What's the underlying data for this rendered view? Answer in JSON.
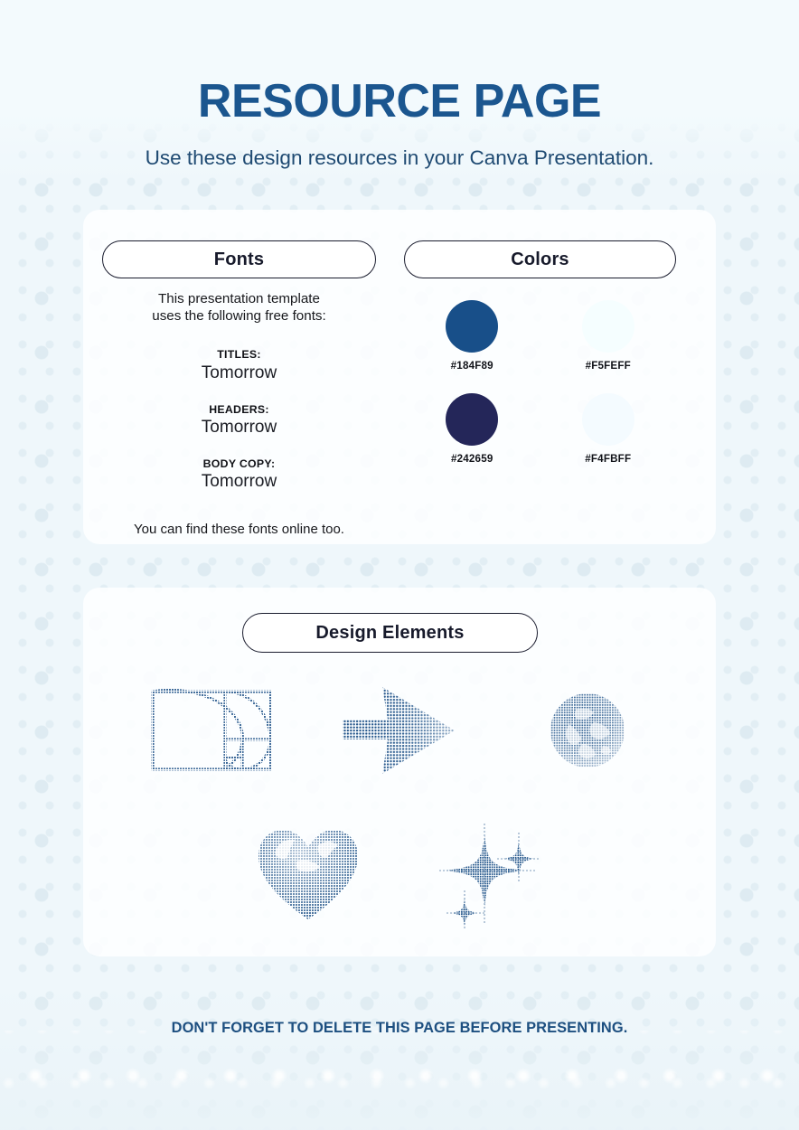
{
  "header": {
    "title": "RESOURCE PAGE",
    "subtitle": "Use these design resources in your Canva Presentation."
  },
  "cards": {
    "resources": {
      "fonts": {
        "pill_label": "Fonts",
        "intro_line_1": "This presentation template",
        "intro_line_2": "uses the following free fonts:",
        "groups": [
          {
            "role": "TITLES:",
            "font": "Tomorrow"
          },
          {
            "role": "HEADERS:",
            "font": "Tomorrow"
          },
          {
            "role": "BODY COPY:",
            "font": "Tomorrow"
          }
        ],
        "footnote": "You can find these fonts online too."
      },
      "colors": {
        "pill_label": "Colors",
        "swatches": [
          {
            "hex_label": "#184F89",
            "hex": "#184F89"
          },
          {
            "hex_label": "#F5FEFF",
            "hex": "#F5FEFF"
          },
          {
            "hex_label": "#242659",
            "hex": "#242659"
          },
          {
            "hex_label": "#F4FBFF",
            "hex": "#F4FBFF"
          }
        ]
      }
    },
    "design_elements": {
      "pill_label": "Design Elements",
      "items": [
        {
          "icon": "golden-ratio-spiral-icon",
          "row": 1
        },
        {
          "icon": "arrow-right-icon",
          "row": 1
        },
        {
          "icon": "globe-earth-icon",
          "row": 1
        },
        {
          "icon": "heart-icon",
          "row": 2
        },
        {
          "icon": "sparkle-stars-icon",
          "row": 2
        }
      ]
    }
  },
  "footer": {
    "note": "DON'T FORGET TO DELETE THIS PAGE BEFORE PRESENTING."
  },
  "theme": {
    "page_background": "#EFF7FB",
    "title_blue": "#1B568F",
    "subtitle_blue": "#1F4A72",
    "graphic_blue": "#1B4F86",
    "ink": "#171A2B"
  }
}
